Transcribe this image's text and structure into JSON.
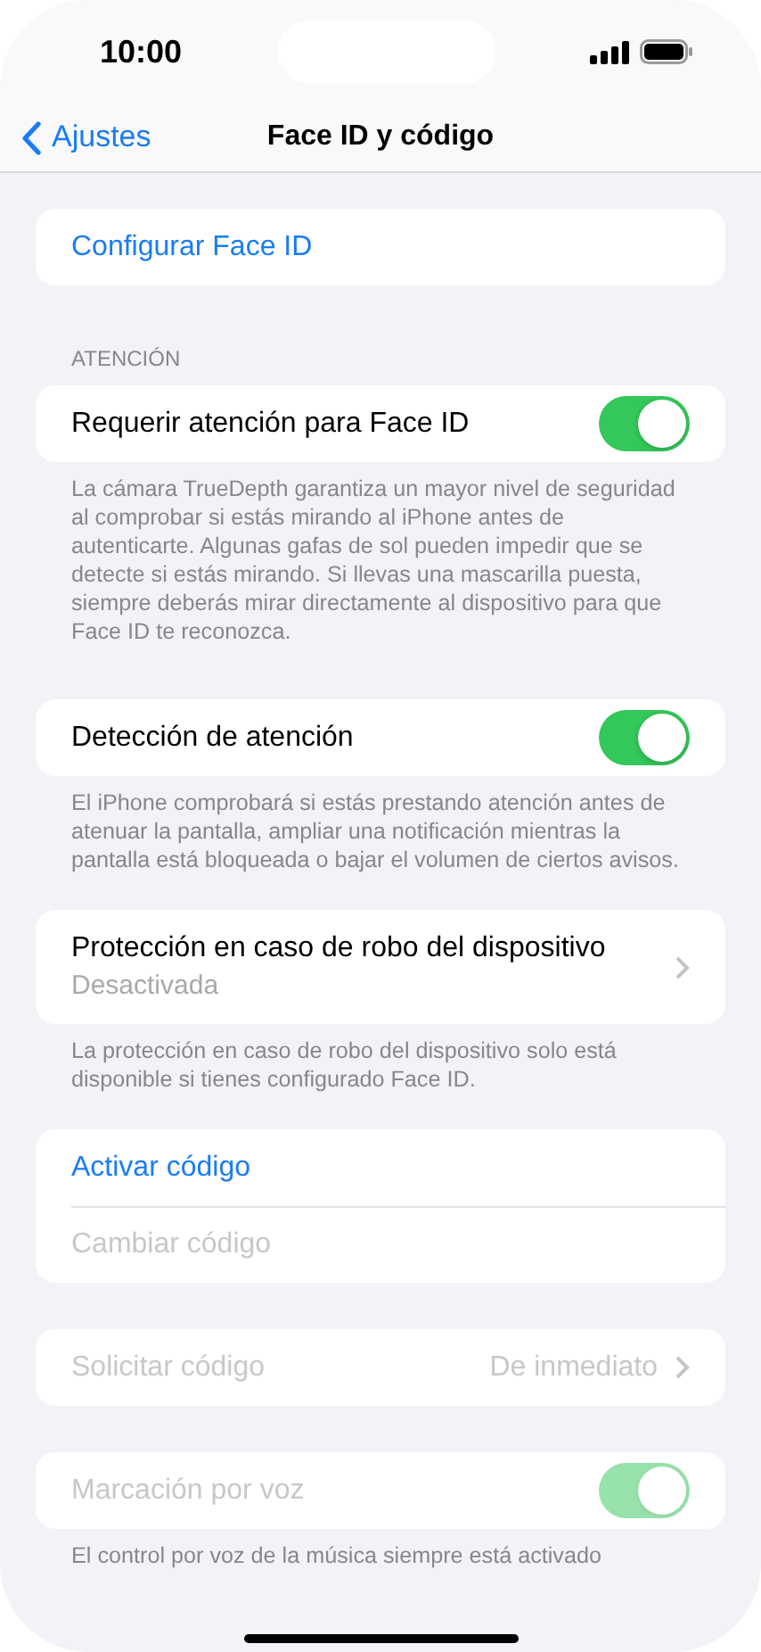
{
  "status_bar": {
    "time": "10:00"
  },
  "nav": {
    "back": "Ajustes",
    "title": "Face ID y código"
  },
  "groups": [
    {
      "rows": [
        {
          "kind": "link",
          "title": "Configurar Face ID",
          "disabled": false
        }
      ]
    },
    {
      "header": "ATENCIÓN",
      "rows": [
        {
          "kind": "toggle",
          "title": "Requerir atención para Face ID",
          "on": true,
          "disabled": false
        }
      ],
      "footer": "La cámara TrueDepth garantiza un mayor nivel de seguridad al comprobar si estás mirando al iPhone antes de autenticarte. Algunas gafas de sol pueden impedir que se detecte si estás mirando. Si llevas una mascarilla puesta, siempre deberás mirar directamente al dispositivo para que Face ID te reconozca."
    },
    {
      "rows": [
        {
          "kind": "toggle",
          "title": "Detección de atención",
          "on": true,
          "disabled": false
        }
      ],
      "footer": "El iPhone comprobará si estás prestando atención antes de atenuar la pantalla, ampliar una notificación mientras la pantalla está bloqueada o bajar el volumen de ciertos avisos."
    },
    {
      "rows": [
        {
          "kind": "detail",
          "title": "Protección en caso de robo del dispositivo",
          "subtitle": "Desactivada",
          "disabled": false
        }
      ],
      "footer": "La protección en caso de robo del dispositivo solo está disponible si tienes configurado Face ID."
    },
    {
      "rows": [
        {
          "kind": "link",
          "title": "Activar código",
          "disabled": false
        },
        {
          "kind": "link",
          "title": "Cambiar código",
          "disabled": true
        }
      ]
    },
    {
      "rows": [
        {
          "kind": "value",
          "title": "Solicitar código",
          "value": "De inmediato",
          "disabled": true
        }
      ]
    },
    {
      "rows": [
        {
          "kind": "toggle",
          "title": "Marcación por voz",
          "on": true,
          "disabled": true
        }
      ],
      "footer": "El control por voz de la música siempre está activado"
    }
  ]
}
